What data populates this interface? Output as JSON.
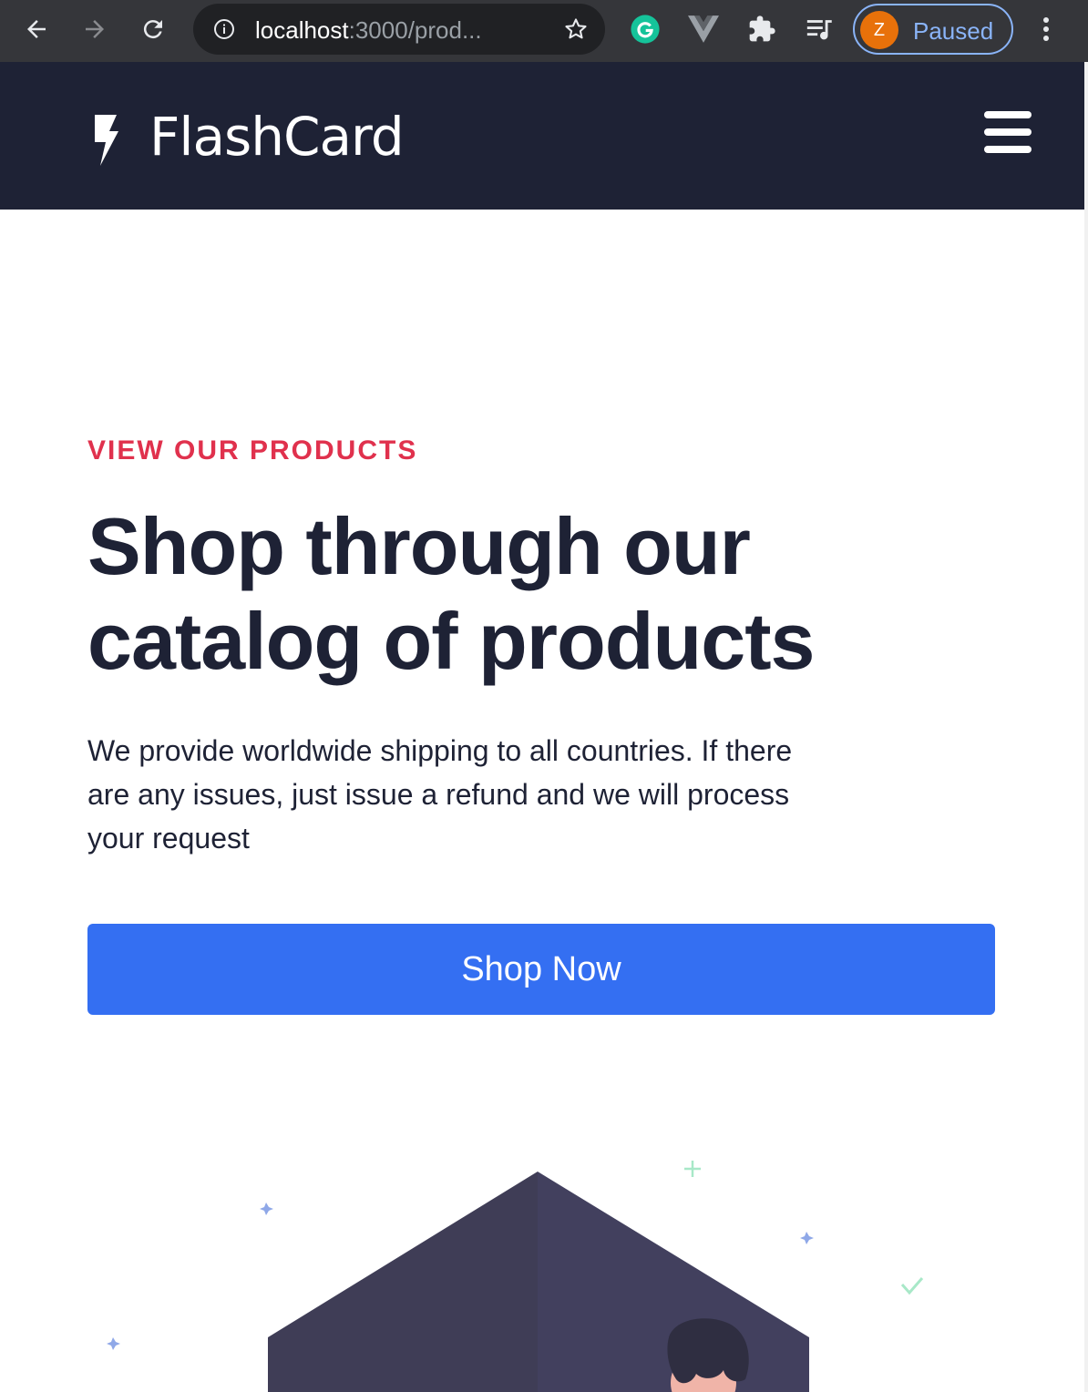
{
  "browser": {
    "url_host": "localhost",
    "url_path": ":3000/prod...",
    "profile_initial": "Z",
    "profile_status": "Paused",
    "colors": {
      "chrome": "#35363a",
      "omnibox": "#202124",
      "accent": "#8ab4f8"
    },
    "icons": [
      "back-arrow-icon",
      "forward-arrow-icon",
      "reload-icon",
      "info-icon",
      "star-icon",
      "grammarly-icon",
      "vue-devtools-icon",
      "extensions-puzzle-icon",
      "media-queue-icon",
      "more-vert-icon"
    ]
  },
  "site": {
    "brand": "FlashCard",
    "colors": {
      "header_bg": "#1e2235",
      "eyebrow": "#e0314d",
      "cta_bg": "#346ff2",
      "text": "#1e2235"
    }
  },
  "hero": {
    "eyebrow": "VIEW OUR PRODUCTS",
    "headline_line1": "Shop through our",
    "headline_line2": "catalog of products",
    "lead_line1": "We provide worldwide shipping to all countries. If there",
    "lead_line2": "are any issues, just issue a refund and we will process",
    "lead_line3": "your request",
    "cta_label": "Shop Now"
  }
}
